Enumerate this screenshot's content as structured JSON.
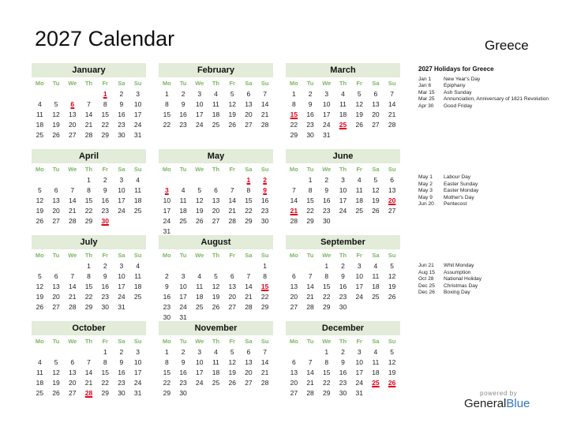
{
  "title": "2027 Calendar",
  "country": "Greece",
  "weekdays": [
    "Mo",
    "Tu",
    "We",
    "Th",
    "Fr",
    "Sa",
    "Su"
  ],
  "colors": {
    "header_bg": "#e2ecd9",
    "weekday": "#7cb861",
    "holiday": "#e3001b",
    "brand_blue": "#2e78c2"
  },
  "months": [
    {
      "name": "January",
      "offset": 4,
      "days": 31,
      "holidays": [
        1,
        6
      ]
    },
    {
      "name": "February",
      "offset": 0,
      "days": 28,
      "holidays": []
    },
    {
      "name": "March",
      "offset": 0,
      "days": 31,
      "holidays": [
        15,
        25
      ]
    },
    {
      "name": "April",
      "offset": 3,
      "days": 30,
      "holidays": [
        30
      ]
    },
    {
      "name": "May",
      "offset": 5,
      "days": 31,
      "holidays": [
        1,
        2,
        3,
        9
      ]
    },
    {
      "name": "June",
      "offset": 1,
      "days": 30,
      "holidays": [
        20,
        21
      ]
    },
    {
      "name": "July",
      "offset": 3,
      "days": 31,
      "holidays": []
    },
    {
      "name": "August",
      "offset": 6,
      "days": 31,
      "holidays": [
        15
      ]
    },
    {
      "name": "September",
      "offset": 2,
      "days": 30,
      "holidays": []
    },
    {
      "name": "October",
      "offset": 4,
      "days": 31,
      "holidays": [
        28
      ]
    },
    {
      "name": "November",
      "offset": 0,
      "days": 30,
      "holidays": []
    },
    {
      "name": "December",
      "offset": 2,
      "days": 31,
      "holidays": [
        25,
        26
      ]
    }
  ],
  "holidays_title": "2027 Holidays for Greece",
  "holiday_groups": [
    [
      {
        "date": "Jan 1",
        "name": "New Year's Day"
      },
      {
        "date": "Jan 6",
        "name": "Epiphany"
      },
      {
        "date": "Mar 15",
        "name": "Ash Sunday"
      },
      {
        "date": "Mar 25",
        "name": "Annunciation, Anniversary of 1821 Revolution"
      },
      {
        "date": "Apr 30",
        "name": "Good Friday"
      }
    ],
    [
      {
        "date": "May 1",
        "name": "Labour Day"
      },
      {
        "date": "May 2",
        "name": "Easter Sunday"
      },
      {
        "date": "May 3",
        "name": "Easter Monday"
      },
      {
        "date": "May 9",
        "name": "Mother's Day"
      },
      {
        "date": "Jun 20",
        "name": "Pentecost"
      }
    ],
    [
      {
        "date": "Jun 21",
        "name": "Whit Monday"
      },
      {
        "date": "Aug 15",
        "name": "Assumption"
      },
      {
        "date": "Oct 28",
        "name": "National Holiday"
      },
      {
        "date": "Dec 25",
        "name": "Christmas Day"
      },
      {
        "date": "Dec 26",
        "name": "Boxing Day"
      }
    ]
  ],
  "footer": {
    "powered_by": "powered by",
    "brand_general": "General",
    "brand_blue": "Blue"
  }
}
